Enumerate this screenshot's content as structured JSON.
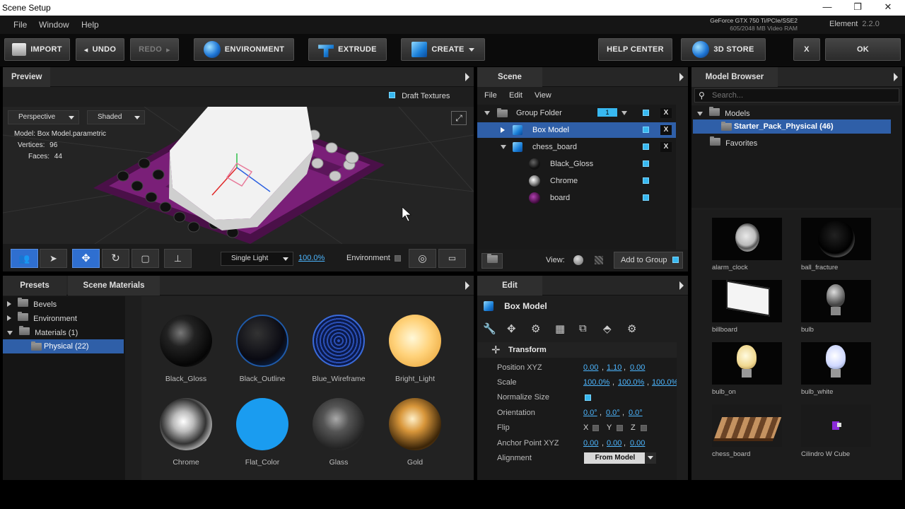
{
  "window": {
    "title": "Scene Setup",
    "minimize": "—",
    "maximize": "❐",
    "close": "✕"
  },
  "menu": {
    "file": "File",
    "window": "Window",
    "help": "Help"
  },
  "gpu": {
    "name": "GeForce GTX 750 Ti/PCIe/SSE2",
    "vram": "605/2048 MB Video RAM"
  },
  "edition": {
    "name": "Element",
    "version": "2.2.0"
  },
  "toolbar": {
    "import": "IMPORT",
    "undo": "UNDO",
    "redo": "REDO",
    "environment": "ENVIRONMENT",
    "extrude": "EXTRUDE",
    "create": "CREATE",
    "help_center": "HELP CENTER",
    "store": "3D STORE",
    "close": "X",
    "ok": "OK"
  },
  "preview": {
    "tab": "Preview",
    "draft_textures": "Draft Textures",
    "view_mode": "Perspective",
    "shading": "Shaded",
    "model_label": "Model:",
    "model_value": "Box Model.parametric",
    "vertices_label": "Vertices:",
    "vertices_value": "96",
    "faces_label": "Faces:",
    "faces_value": "44",
    "light_mode": "Single Light",
    "light_percent": "100.0%",
    "environment_label": "Environment"
  },
  "scene": {
    "tab": "Scene",
    "menu": {
      "file": "File",
      "edit": "Edit",
      "view": "View"
    },
    "items": [
      {
        "label": "Group Folder",
        "badge": "1"
      },
      {
        "label": "Box Model"
      },
      {
        "label": "chess_board"
      },
      {
        "label": "Black_Gloss"
      },
      {
        "label": "Chrome"
      },
      {
        "label": "board"
      }
    ],
    "view_label": "View:",
    "add_to_group": "Add to Group"
  },
  "model_browser": {
    "tab": "Model Browser",
    "search_placeholder": "Search...",
    "tree": {
      "models": "Models",
      "starter": "Starter_Pack_Physical (46)",
      "favorites": "Favorites"
    },
    "items": [
      "alarm_clock",
      "ball_fracture",
      "billboard",
      "bulb",
      "bulb_on",
      "bulb_white",
      "chess_board",
      "Cilindro W Cube"
    ]
  },
  "presets": {
    "tab_presets": "Presets",
    "tab_scene_materials": "Scene Materials",
    "tree": {
      "bevels": "Bevels",
      "environment": "Environment",
      "materials": "Materials (1)",
      "physical": "Physical (22)"
    },
    "materials": [
      "Black_Gloss",
      "Black_Outline",
      "Blue_Wireframe",
      "Bright_Light",
      "Chrome",
      "Flat_Color",
      "Glass",
      "Gold"
    ]
  },
  "edit": {
    "tab": "Edit",
    "object_name": "Box Model",
    "section": "Transform",
    "rows": {
      "position_label": "Position XYZ",
      "position": [
        "0.00",
        "1.10",
        "0.00"
      ],
      "scale_label": "Scale",
      "scale": [
        "100.0%",
        "100.0%",
        "100.0%"
      ],
      "normalize_label": "Normalize Size",
      "orientation_label": "Orientation",
      "orientation": [
        "0.0°",
        "0.0°",
        "0.0°"
      ],
      "flip_label": "Flip",
      "flip_axes": [
        "X",
        "Y",
        "Z"
      ],
      "anchor_label": "Anchor Point XYZ",
      "anchor": [
        "0.00",
        "0.00",
        "0.00"
      ],
      "alignment_label": "Alignment",
      "alignment_value": "From Model"
    }
  },
  "colors": {
    "accent": "#38b8f0",
    "selection": "#2f5fa8",
    "panel": "#1e1e1e"
  }
}
